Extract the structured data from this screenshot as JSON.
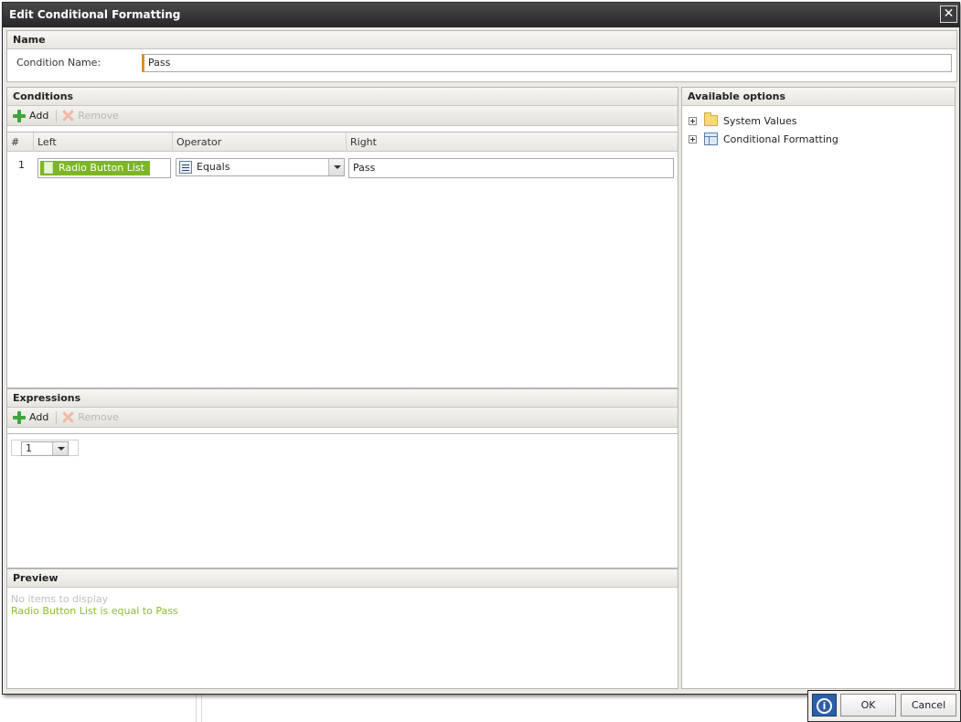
{
  "dialog": {
    "title": "Edit Conditional Formatting",
    "close_glyph": "✕"
  },
  "name_section": {
    "header": "Name",
    "label": "Condition Name:",
    "value": "Pass"
  },
  "conditions": {
    "header": "Conditions",
    "add_label": "Add",
    "remove_label": "Remove",
    "columns": [
      "#",
      "Left",
      "Operator",
      "Right"
    ],
    "rows": [
      {
        "num": "1",
        "left": "Radio Button List",
        "operator": "Equals",
        "right": "Pass"
      }
    ]
  },
  "expressions": {
    "header": "Expressions",
    "add_label": "Add",
    "remove_label": "Remove",
    "selected": "1"
  },
  "preview": {
    "header": "Preview",
    "empty_text": "No items to display",
    "text": "Radio Button List is equal to Pass"
  },
  "available_options": {
    "header": "Available options",
    "items": [
      {
        "label": "System Values",
        "icon": "folder-icon"
      },
      {
        "label": "Conditional Formatting",
        "icon": "table-icon"
      }
    ]
  },
  "footer": {
    "info_glyph": "i",
    "ok_label": "OK",
    "cancel_label": "Cancel"
  }
}
